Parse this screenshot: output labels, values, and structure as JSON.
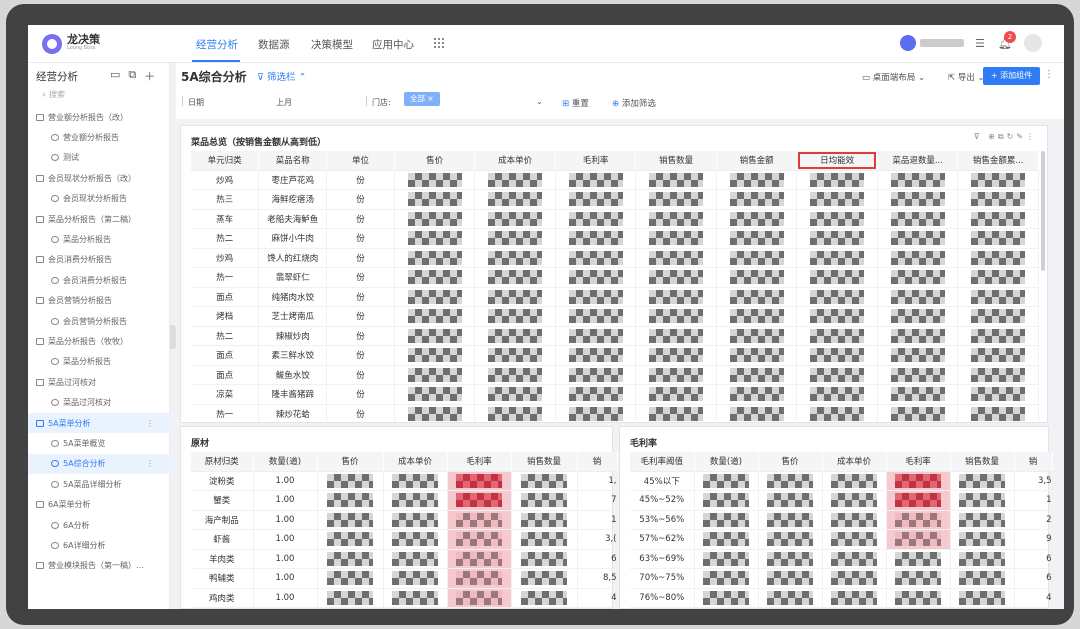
{
  "app": {
    "logo_cn": "龙决策",
    "logo_en": "Loong Boss"
  },
  "nav": {
    "tabs": [
      "经营分析",
      "数据源",
      "决策模型",
      "应用中心"
    ],
    "badge": "2"
  },
  "sidebar": {
    "title": "经营分析",
    "search_placeholder": "搜索",
    "items": [
      {
        "label": "营业额分析报告（改）",
        "level": 0
      },
      {
        "label": "营业额分析报告",
        "level": 1
      },
      {
        "label": "测试",
        "level": 1
      },
      {
        "label": "会员现状分析报告（改）",
        "level": 0
      },
      {
        "label": "会员现状分析报告",
        "level": 1
      },
      {
        "label": "菜品分析报告（第二稿）",
        "level": 0
      },
      {
        "label": "菜品分析报告",
        "level": 1
      },
      {
        "label": "会员消费分析报告",
        "level": 0
      },
      {
        "label": "会员消费分析报告",
        "level": 1
      },
      {
        "label": "会员营销分析报告",
        "level": 0
      },
      {
        "label": "会员营销分析报告",
        "level": 1
      },
      {
        "label": "菜品分析报告（牧牧）",
        "level": 0
      },
      {
        "label": "菜品分析报告",
        "level": 1
      },
      {
        "label": "菜品过河核对",
        "level": 0
      },
      {
        "label": "菜品过河核对",
        "level": 1
      },
      {
        "label": "5A菜单分析",
        "level": 0,
        "sel": true
      },
      {
        "label": "5A菜单概览",
        "level": 1
      },
      {
        "label": "5A综合分析",
        "level": 1,
        "sel": true
      },
      {
        "label": "5A菜品详细分析",
        "level": 1
      },
      {
        "label": "6A菜单分析",
        "level": 0
      },
      {
        "label": "6A分析",
        "level": 1
      },
      {
        "label": "6A详细分析",
        "level": 1
      },
      {
        "label": "营业模块报告（第一稿）...",
        "level": 0
      }
    ]
  },
  "header": {
    "title": "5A综合分析",
    "filter_toggle": "筛选栏",
    "layout": "桌面端布局",
    "export": "导出",
    "add_component": "+ 添加组件"
  },
  "filters": {
    "date_label": "日期",
    "date_value": "上月",
    "store_label": "门店:",
    "store_chip": "全部",
    "reset": "重置",
    "add_filter": "添加筛选"
  },
  "dish_table": {
    "title": "菜品总览（按销售金额从高到低）",
    "columns": [
      "单元归类",
      "菜品名称",
      "单位",
      "售价",
      "成本单价",
      "毛利率",
      "销售数量",
      "销售金额",
      "日均能效",
      "菜品退数量...",
      "销售金额累..."
    ],
    "rows": [
      [
        "炒鸡",
        "枣庄芦花鸡",
        "份"
      ],
      [
        "热三",
        "海鲜疙瘩汤",
        "份"
      ],
      [
        "蒸车",
        "老船夫海鲈鱼",
        "份"
      ],
      [
        "热二",
        "麻饼小牛肉",
        "份"
      ],
      [
        "炒鸡",
        "馋人的红烧肉",
        "份"
      ],
      [
        "热一",
        "翡翠虾仁",
        "份"
      ],
      [
        "面点",
        "纯猪肉水饺",
        "份"
      ],
      [
        "烤档",
        "芝士烤南瓜",
        "份"
      ],
      [
        "热二",
        "辣椒炒肉",
        "份"
      ],
      [
        "面点",
        "素三鲜水饺",
        "份"
      ],
      [
        "面点",
        "鲅鱼水饺",
        "份"
      ],
      [
        "凉菜",
        "隆丰酱猪蹄",
        "份"
      ],
      [
        "热一",
        "辣炒花蛤",
        "份"
      ]
    ]
  },
  "material_table": {
    "title": "原材",
    "columns": [
      "原材归类",
      "数量(道)",
      "售价",
      "成本单价",
      "毛利率",
      "销售数量",
      "销"
    ],
    "rows": [
      [
        "淀粉类",
        "1.00",
        "1,"
      ],
      [
        "蟹类",
        "1.00",
        "7"
      ],
      [
        "海产制品",
        "1.00",
        "1"
      ],
      [
        "虾酱",
        "1.00",
        "3,("
      ],
      [
        "羊肉类",
        "1.00",
        "6"
      ],
      [
        "鸭辅类",
        "1.00",
        "8,5"
      ],
      [
        "鸡肉类",
        "1.00",
        "4"
      ]
    ]
  },
  "margin_table": {
    "title": "毛利率",
    "columns": [
      "毛利率阈值",
      "数量(道)",
      "售价",
      "成本单价",
      "毛利率",
      "销售数量",
      "销"
    ],
    "rows": [
      [
        "45%以下",
        "3,5"
      ],
      [
        "45%~52%",
        "1"
      ],
      [
        "53%~56%",
        "2"
      ],
      [
        "57%~62%",
        "9"
      ],
      [
        "63%~69%",
        "6"
      ],
      [
        "70%~75%",
        "6"
      ],
      [
        "76%~80%",
        "4"
      ]
    ]
  }
}
